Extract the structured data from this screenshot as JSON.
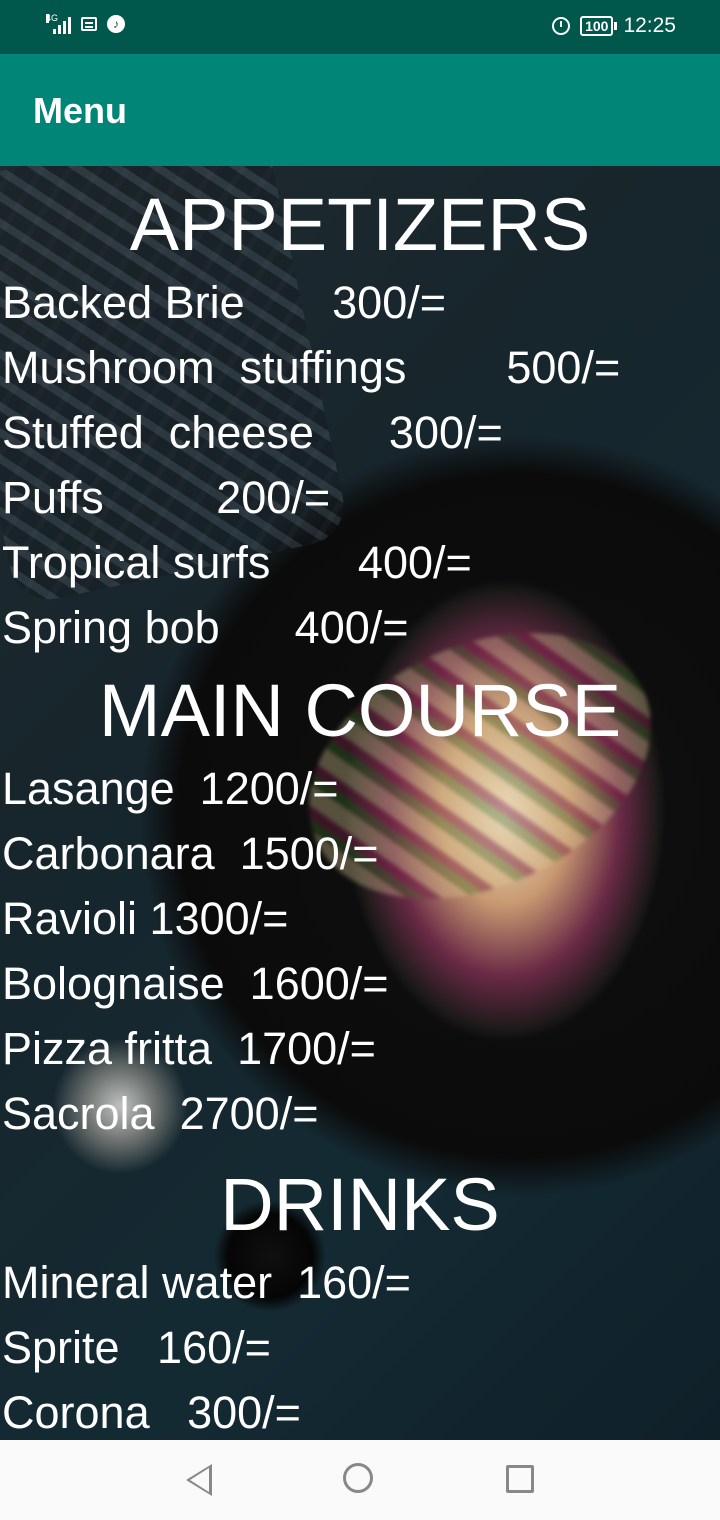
{
  "status_bar": {
    "network": "4G",
    "time": "12:25",
    "battery": "100"
  },
  "app_bar": {
    "title": "Menu"
  },
  "menu": {
    "appetizers_heading": "APPETIZERS",
    "appetizers": [
      "Backed Brie       300/=",
      "Mushroom  stuffings        500/=",
      "Stuffed  cheese      300/=",
      "Puffs         200/=",
      "Tropical surfs       400/=",
      "Spring bob      400/="
    ],
    "main_course_heading": "MAIN COURSE",
    "main_course": [
      "Lasange  1200/=",
      "Carbonara  1500/=",
      "Ravioli 1300/=",
      "Bolognaise  1600/=",
      "Pizza fritta  1700/=",
      "Sacrola  2700/="
    ],
    "drinks_heading": "DRINKS",
    "drinks": [
      "Mineral water  160/=",
      "Sprite   160/=",
      "Corona   300/="
    ]
  },
  "icons": {
    "signal": "signal-icon",
    "message": "message-icon",
    "music": "music-icon",
    "alarm": "alarm-icon",
    "battery": "battery-icon",
    "back": "back-icon",
    "home": "home-icon",
    "recents": "recents-icon"
  },
  "colors": {
    "status_bar": "#00574b",
    "app_bar": "#008577",
    "text": "#ffffff",
    "nav_bar": "#fafafa"
  }
}
